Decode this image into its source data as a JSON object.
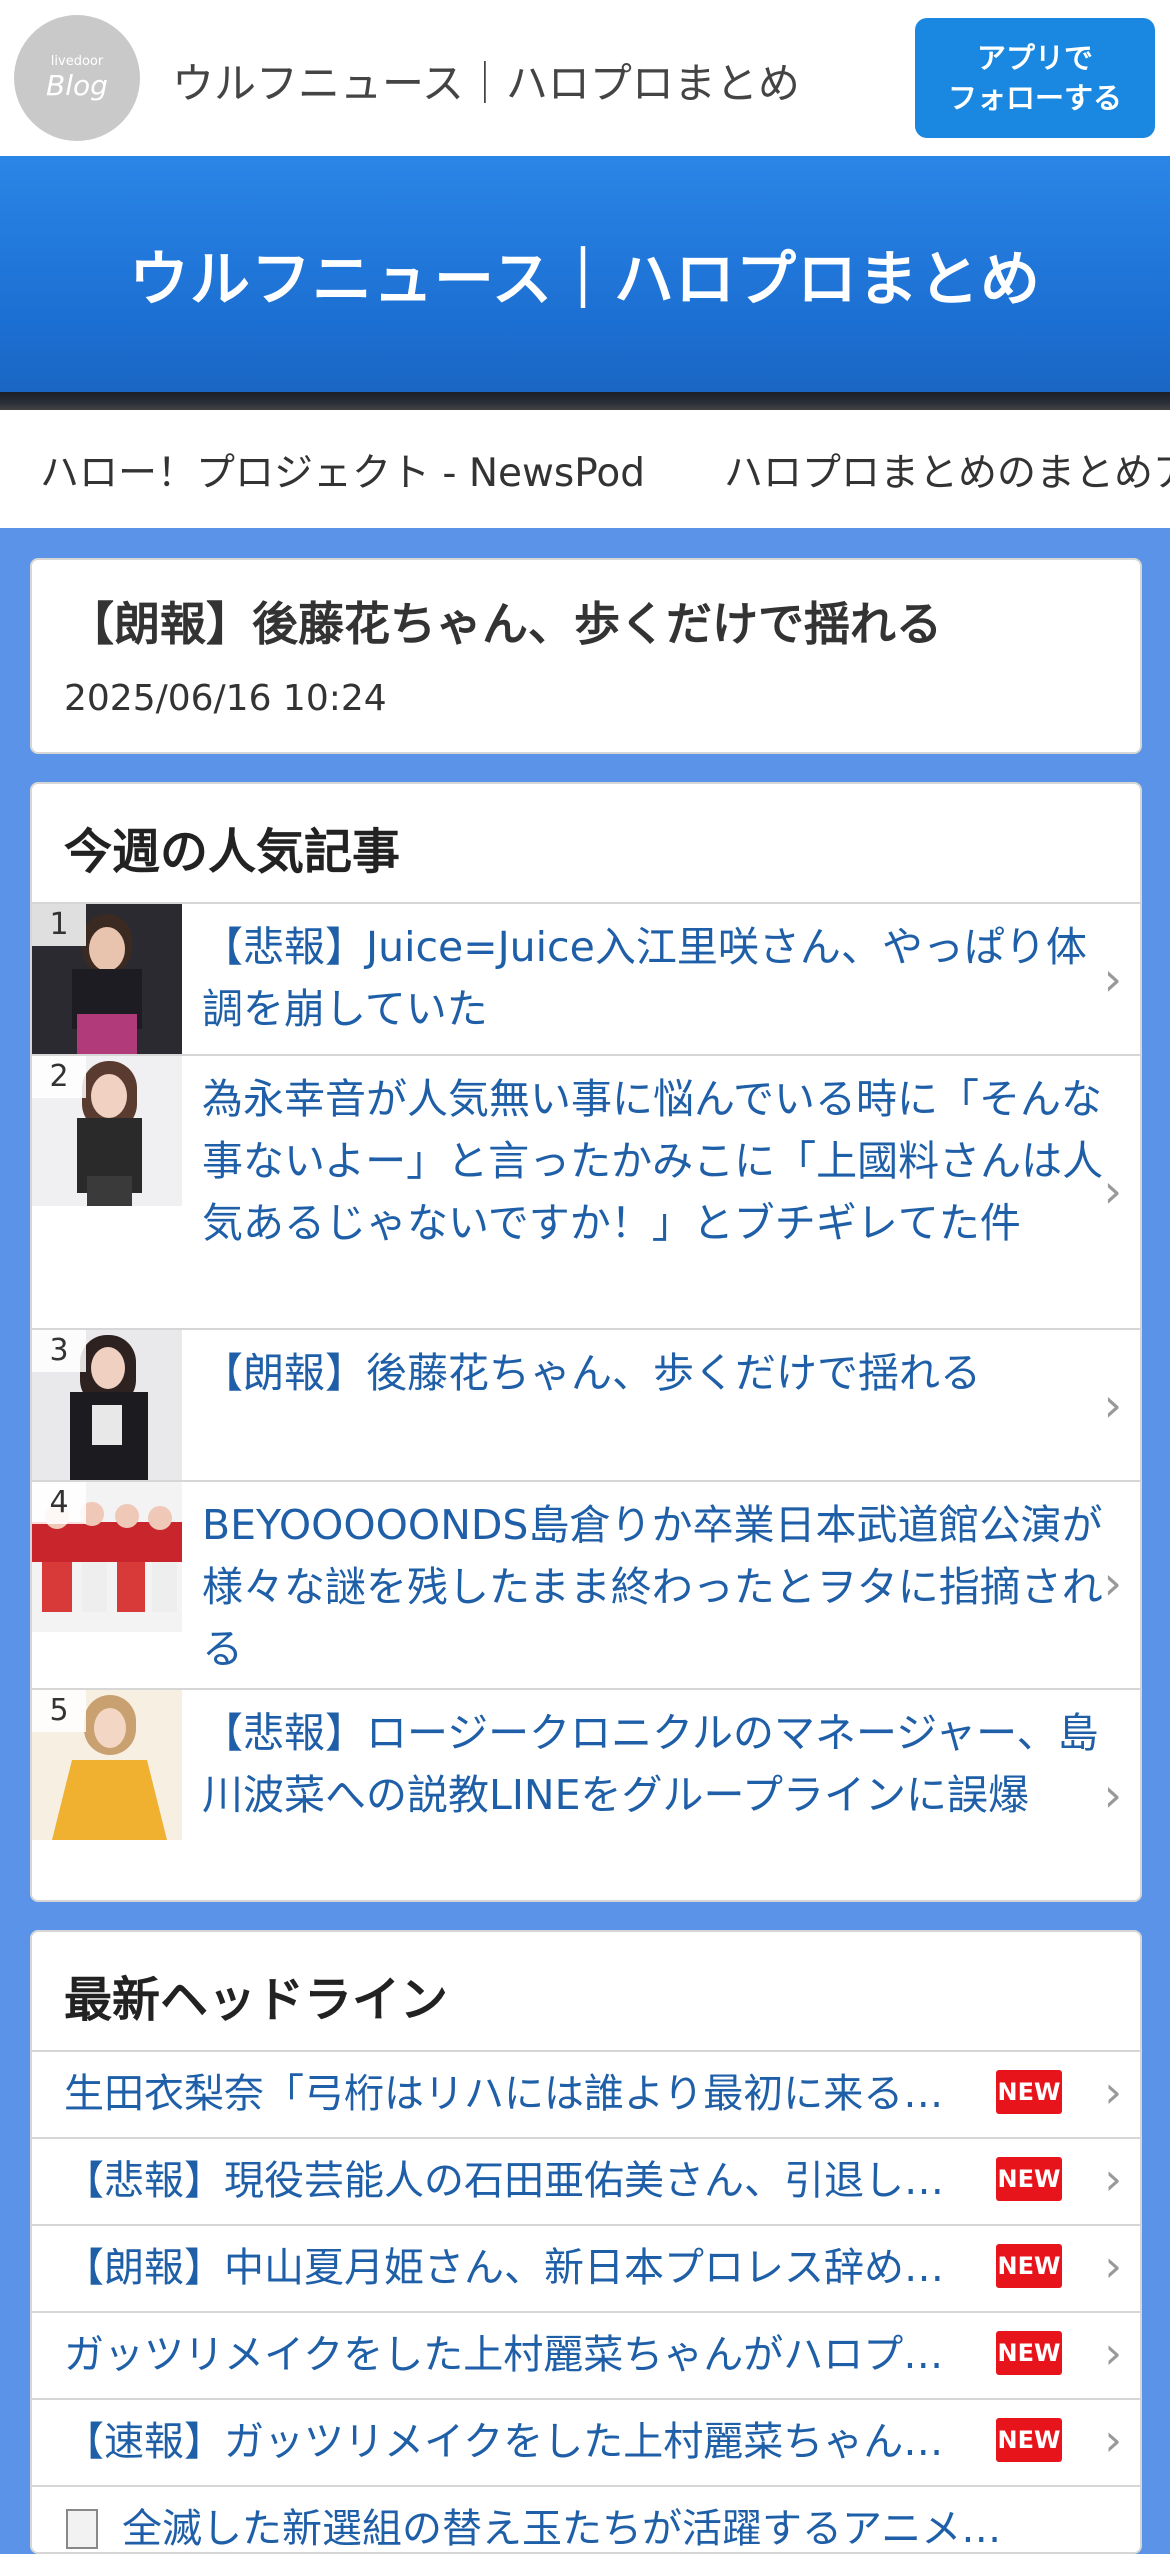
{
  "header": {
    "logo_small": "livedoor",
    "logo_big": "Blog",
    "site_name": "ウルフニュース｜ハロプロまとめ",
    "follow_line1": "アプリで",
    "follow_line2": "フォローする"
  },
  "banner": {
    "title": "ウルフニュース｜ハロプロまとめ"
  },
  "links": [
    "ハロー！プロジェクト - NewsPod",
    "ハロプロまとめのまとめア"
  ],
  "article": {
    "title": "【朗報】後藤花ちゃん、歩くだけで揺れる",
    "date": "2025/06/16 10:24"
  },
  "popular": {
    "title": "今週の人気記事",
    "items": [
      {
        "rank": "1",
        "text": "【悲報】Juice=Juice入江里咲さん、やっぱり体調を崩していた"
      },
      {
        "rank": "2",
        "text": "為永幸音が人気無い事に悩んでいる時に「そんな事ないよー」と言ったかみこに「上國料さんは人気あるじゃないですか！」とブチギレてた件"
      },
      {
        "rank": "3",
        "text": "【朗報】後藤花ちゃん、歩くだけで揺れる"
      },
      {
        "rank": "4",
        "text": "BEYOOOOONDS島倉りか卒業日本武道館公演が様々な謎を残したまま終わったとヲタに指摘される"
      },
      {
        "rank": "5",
        "text": "【悲報】ロージークロニクルのマネージャー、島川波菜への説教LINEをグループラインに誤爆"
      }
    ]
  },
  "headlines": {
    "title": "最新ヘッドライン",
    "new_label": "NEW",
    "items": [
      {
        "text": "生田衣梨奈「弓桁はリハには誰より最初に来る…"
      },
      {
        "text": "【悲報】現役芸能人の石田亜佑美さん、引退し…"
      },
      {
        "text": "【朗報】中山夏月姫さん、新日本プロレス辞め…"
      },
      {
        "text": "ガッツリメイクをした上村麗菜ちゃんがハロプ…"
      },
      {
        "text": "【速報】ガッツリメイクをした上村麗菜ちゃん…"
      },
      {
        "text": "全滅した新選組の替え玉たちが活躍するアニメ…"
      }
    ]
  },
  "colors": {
    "accent": "#1a88e0",
    "page_bg": "#5b93e8",
    "link": "#1f5fa8",
    "new_badge": "#e8141c"
  }
}
